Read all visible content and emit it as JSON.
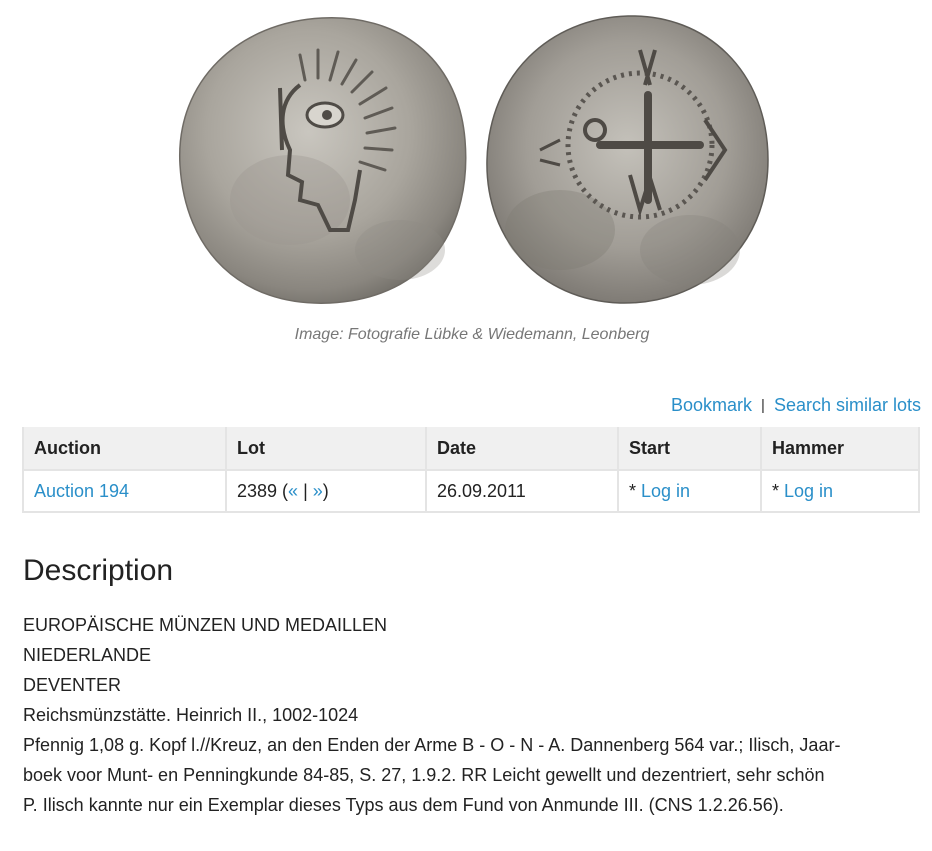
{
  "image": {
    "caption": "Image: Fotografie Lübke & Wiedemann, Leonberg"
  },
  "actions": {
    "bookmark": "Bookmark",
    "separator": "|",
    "search_similar": "Search similar lots"
  },
  "lot_table": {
    "headers": [
      "Auction",
      "Lot",
      "Date",
      "Start",
      "Hammer"
    ],
    "row": {
      "auction": "Auction 194",
      "lot_number": "2389",
      "lot_open": " (",
      "prev": "«",
      "mid_sep": " | ",
      "next": "»",
      "lot_close": ")",
      "date": "26.09.2011",
      "start_prefix": "* ",
      "start_link": "Log in",
      "hammer_prefix": "* ",
      "hammer_link": "Log in"
    }
  },
  "description": {
    "title": "Description",
    "lines": [
      "EUROPÄISCHE MÜNZEN UND MEDAILLEN",
      "NIEDERLANDE",
      "DEVENTER",
      "Reichsmünzstätte. Heinrich II., 1002-1024",
      "Pfennig 1,08 g. Kopf l.//Kreuz, an den Enden der Arme B - O - N - A. Dannenberg 564 var.; Ilisch, Jaar-",
      "boek voor Munt- en Penningkunde 84-85, S. 27, 1.9.2. RR Leicht gewellt und dezentriert, sehr schön",
      "P. Ilisch kannte nur ein Exemplar dieses Typs aus dem Fund von Anmunde III. (CNS 1.2.26.56)."
    ]
  },
  "colors": {
    "link": "#2a8fc9",
    "caption": "#777777",
    "table_header_bg": "#f0f0f0",
    "border": "#e4e4e4"
  }
}
